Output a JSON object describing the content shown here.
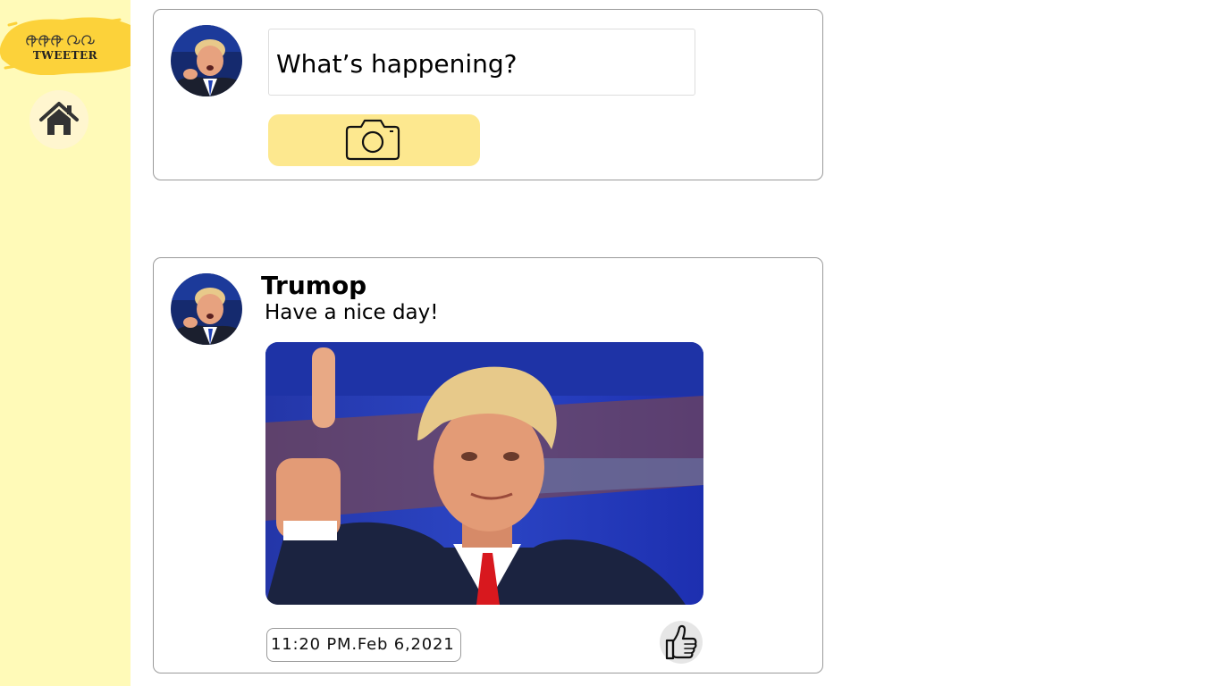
{
  "sidebar": {
    "logo_text": "TWEETER",
    "logo_icon": "tweeter-logo-icon",
    "home_icon": "home-icon",
    "colors": {
      "background": "#fffab8",
      "logo_splash": "#fcd23a"
    }
  },
  "compose": {
    "placeholder": "What’s happening?",
    "avatar_icon": "user-avatar",
    "camera_icon": "camera-icon",
    "colors": {
      "button": "#fde88f"
    }
  },
  "post": {
    "author": "Trumop",
    "text": "Have a nice day!",
    "image": "post-photo",
    "timestamp": "11:20 PM.Feb 6,2021",
    "like_icon": "thumbs-up-icon"
  }
}
